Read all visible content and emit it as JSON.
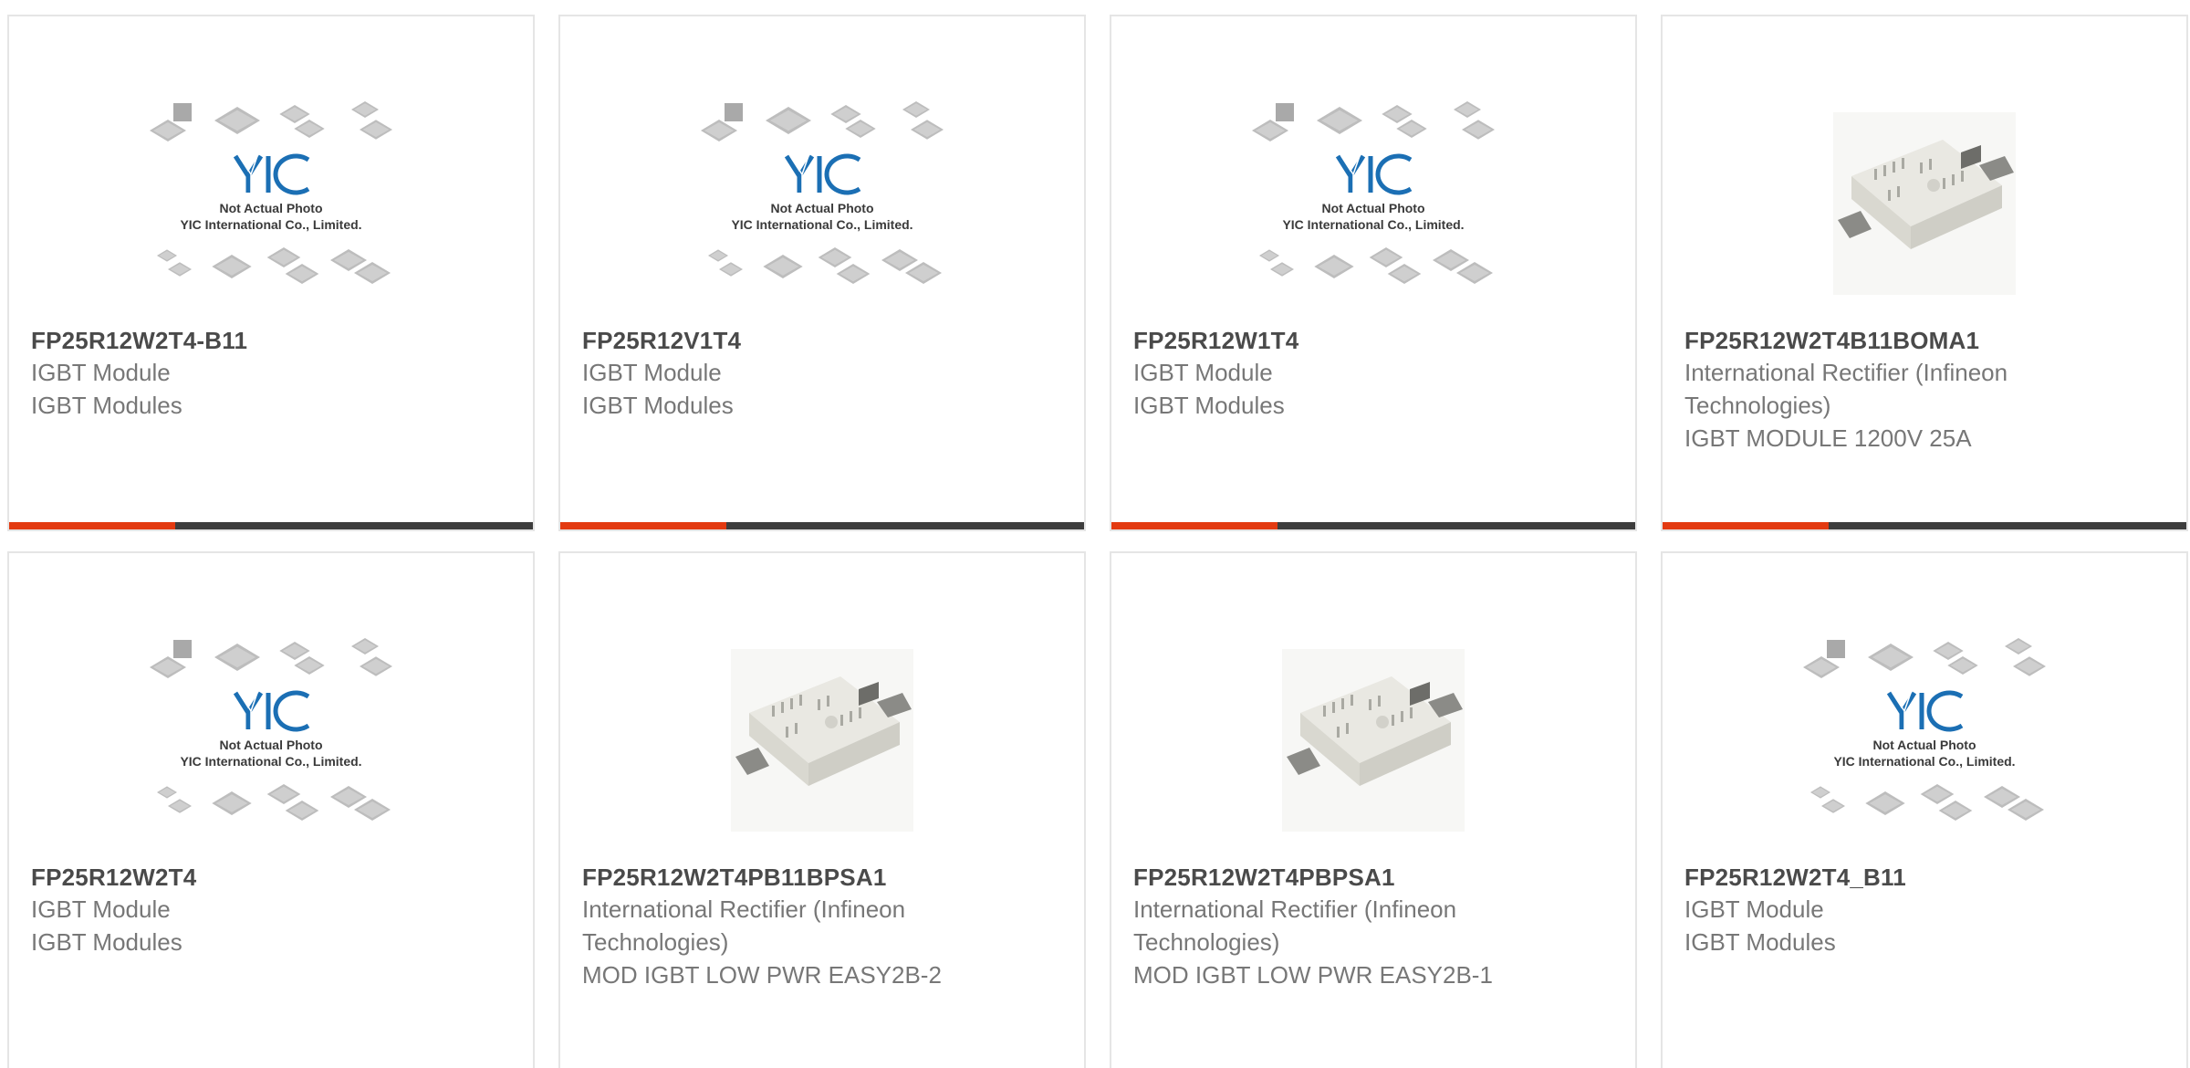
{
  "placeholder": {
    "logo_text": "YIC",
    "caption_1": "Not Actual Photo",
    "caption_2": "YIC International Co., Limited."
  },
  "accent_colors": {
    "red": "#e33a11",
    "dark": "#3d3d3d"
  },
  "products": [
    {
      "part": "FP25R12W2T4-B11",
      "line1": "IGBT Module",
      "line2": "IGBT Modules",
      "image": "placeholder"
    },
    {
      "part": "FP25R12V1T4",
      "line1": "IGBT Module",
      "line2": "IGBT Modules",
      "image": "placeholder"
    },
    {
      "part": "FP25R12W1T4",
      "line1": "IGBT Module",
      "line2": "IGBT Modules",
      "image": "placeholder"
    },
    {
      "part": "FP25R12W2T4B11BOMA1",
      "line1": "International Rectifier (Infineon Technologies)",
      "line2": "IGBT MODULE 1200V 25A",
      "image": "igbt-module-photo"
    },
    {
      "part": "FP25R12W2T4",
      "line1": "IGBT Module",
      "line2": "IGBT Modules",
      "image": "placeholder"
    },
    {
      "part": "FP25R12W2T4PB11BPSA1",
      "line1": "International Rectifier (Infineon Technologies)",
      "line2": "MOD IGBT LOW PWR EASY2B-2",
      "image": "igbt-module-photo"
    },
    {
      "part": "FP25R12W2T4PBPSA1",
      "line1": "International Rectifier (Infineon Technologies)",
      "line2": "MOD IGBT LOW PWR EASY2B-1",
      "image": "igbt-module-photo"
    },
    {
      "part": "FP25R12W2T4_B11",
      "line1": "IGBT Module",
      "line2": "IGBT Modules",
      "image": "placeholder"
    }
  ]
}
